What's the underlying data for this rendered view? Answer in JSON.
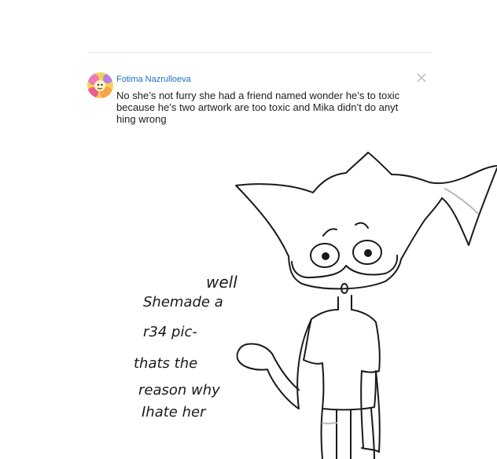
{
  "colors": {
    "author_name": "#1d6fc4",
    "comment_text": "#202020",
    "close_icon": "#b8b8b8",
    "ink": "#1a1a1a",
    "shade": "#b9b9b9"
  },
  "comment": {
    "author": "Fotima Nazrulloeva",
    "lines": [
      "No she’s not furry she had a friend named wonder he’s to toxic",
      "because he’s two artwork are too toxic and Mika didn’t do anyt",
      "hing wrong"
    ],
    "avatar_icon": "avatar-image",
    "close_icon": "close-icon"
  },
  "drawing": {
    "speech_well": "well",
    "speech_lines": [
      "Shemade a",
      "r34 pic-",
      "thats the",
      "reason why",
      "Ihate her"
    ]
  }
}
